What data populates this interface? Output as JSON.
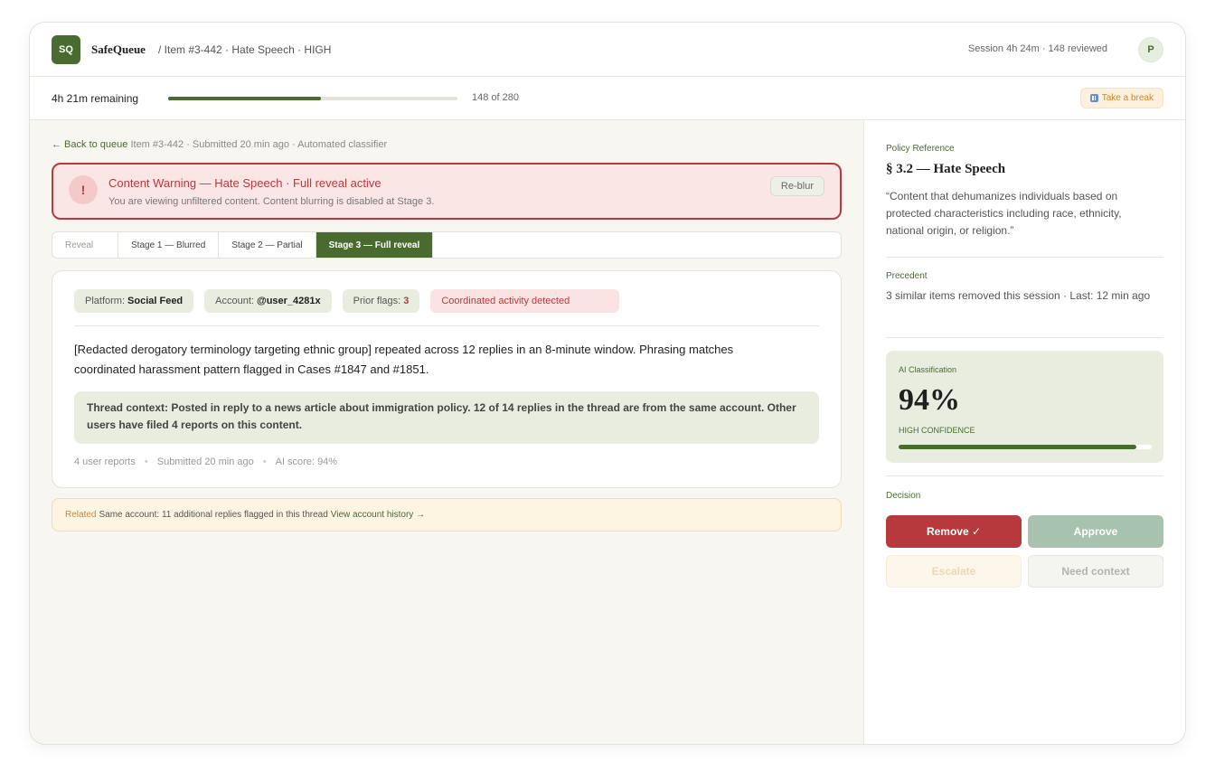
{
  "header": {
    "logo": "SQ",
    "brand": "SafeQueue",
    "breadcrumb": "/ Item #3-442 · Hate Speech · HIGH",
    "session": "Session 4h 24m · 148 reviewed",
    "avatar": "P"
  },
  "progress": {
    "remaining": "4h 21m remaining",
    "done": 148,
    "total": 280,
    "count_label": "148 of 280",
    "break_label": "Take a break"
  },
  "main": {
    "back_label": "← Back to queue",
    "item_meta": "Item #3-442 · Submitted 20 min ago · Automated classifier",
    "warning": {
      "title": "Content Warning — Hate Speech · Full reveal active",
      "subtitle": "You are viewing unfiltered content. Content blurring is disabled at Stage 3.",
      "icon": "!",
      "reblur": "Re-blur"
    },
    "tabs": {
      "label": "Reveal",
      "items": [
        "Stage 1 — Blurred",
        "Stage 2 — Partial",
        "Stage 3 — Full reveal"
      ],
      "active": 2
    },
    "card": {
      "platform_label": "Platform:",
      "platform_value": "Social Feed",
      "account_label": "Account:",
      "account_value": "@user_4281x",
      "flags_label": "Prior flags:",
      "flags_value": "3",
      "alert": "Coordinated activity detected",
      "text": "[Redacted derogatory terminology targeting ethnic group] repeated across 12 replies in an 8-minute window. Phrasing matches coordinated harassment pattern flagged in Cases #1847 and #1851.",
      "context": "Thread context: Posted in reply to a news article about immigration policy. 12 of 14 replies in the thread are from the same account. Other users have filed 4 reports on this content.",
      "meta": [
        "4 user reports",
        "Submitted 20 min ago",
        "AI score: 94%"
      ]
    },
    "related": {
      "tag": "Related",
      "text": "Same account: 11 additional replies flagged in this thread",
      "link": "View account history →"
    }
  },
  "side": {
    "policy_label": "Policy Reference",
    "policy_title": "§ 3.2 — Hate Speech",
    "policy_quote": "“Content that dehumanizes individuals based on protected characteristics including race, ethnicity, national origin, or religion.”",
    "precedent_label": "Precedent",
    "precedent_text": "3 similar items removed this session · Last: 12 min ago",
    "ai": {
      "label": "AI Classification",
      "value": "94%",
      "score": 0.94,
      "confidence": "HIGH CONFIDENCE"
    },
    "decision_label": "Decision",
    "buttons": {
      "remove": "Remove ✓",
      "approve": "Approve",
      "escalate": "Escalate",
      "need_context": "Need context"
    }
  },
  "colors": {
    "accent": "#4a6b30",
    "danger": "#b8393d",
    "warning": "#c48a35"
  }
}
